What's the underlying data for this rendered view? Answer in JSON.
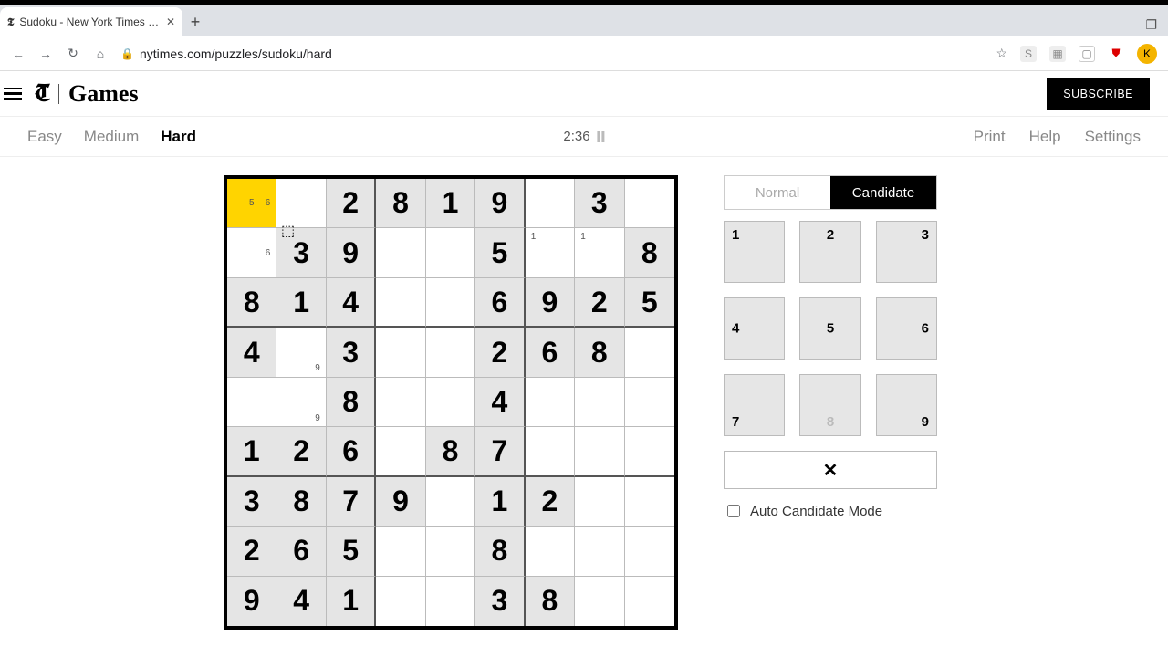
{
  "browser": {
    "tab_title": "Sudoku - New York Times Numb",
    "url": "nytimes.com/puzzles/sudoku/hard",
    "avatar_initial": "K"
  },
  "header": {
    "brand_t": "T",
    "brand_word": "Games",
    "subscribe": "SUBSCRIBE"
  },
  "subnav": {
    "difficulties": [
      "Easy",
      "Medium",
      "Hard"
    ],
    "active": "Hard",
    "timer": "2:36",
    "right": [
      "Print",
      "Help",
      "Settings"
    ]
  },
  "mode": {
    "normal": "Normal",
    "candidate": "Candidate",
    "active": "Candidate"
  },
  "keypad": [
    "1",
    "2",
    "3",
    "4",
    "5",
    "6",
    "7",
    "8",
    "9"
  ],
  "keypad_used": [
    8
  ],
  "erase_icon": "✕",
  "auto_label": "Auto Candidate Mode",
  "selected_cell": [
    0,
    0
  ],
  "board": [
    [
      null,
      null,
      "2",
      "8",
      "1",
      "9",
      null,
      "3",
      null
    ],
    [
      null,
      "3",
      "9",
      null,
      null,
      "5",
      null,
      null,
      "8"
    ],
    [
      "8",
      "1",
      "4",
      null,
      null,
      "6",
      "9",
      "2",
      "5"
    ],
    [
      "4",
      null,
      "3",
      null,
      null,
      "2",
      "6",
      "8",
      null
    ],
    [
      null,
      null,
      "8",
      null,
      null,
      "4",
      null,
      null,
      null
    ],
    [
      "1",
      "2",
      "6",
      null,
      "8",
      "7",
      null,
      null,
      null
    ],
    [
      "3",
      "8",
      "7",
      "9",
      null,
      "1",
      "2",
      null,
      null
    ],
    [
      "2",
      "6",
      "5",
      null,
      null,
      "8",
      null,
      null,
      null
    ],
    [
      "9",
      "4",
      "1",
      null,
      null,
      "3",
      "8",
      null,
      null
    ]
  ],
  "givens": [
    [
      0,
      0,
      1,
      1,
      1,
      1,
      0,
      1,
      0
    ],
    [
      0,
      1,
      1,
      0,
      0,
      1,
      0,
      0,
      1
    ],
    [
      1,
      1,
      1,
      0,
      0,
      1,
      1,
      1,
      1
    ],
    [
      1,
      0,
      1,
      0,
      0,
      1,
      1,
      1,
      0
    ],
    [
      0,
      0,
      1,
      0,
      0,
      1,
      0,
      0,
      0
    ],
    [
      1,
      1,
      1,
      0,
      1,
      1,
      0,
      0,
      0
    ],
    [
      1,
      1,
      1,
      1,
      0,
      1,
      1,
      0,
      0
    ],
    [
      1,
      1,
      1,
      0,
      0,
      1,
      0,
      0,
      0
    ],
    [
      1,
      1,
      1,
      0,
      0,
      1,
      1,
      0,
      0
    ]
  ],
  "candidates": {
    "0,0": [
      5,
      6
    ],
    "1,0": [
      6
    ],
    "1,6": [
      1
    ],
    "1,7": [
      1
    ],
    "3,1": [
      9
    ],
    "4,1": [
      9
    ]
  }
}
